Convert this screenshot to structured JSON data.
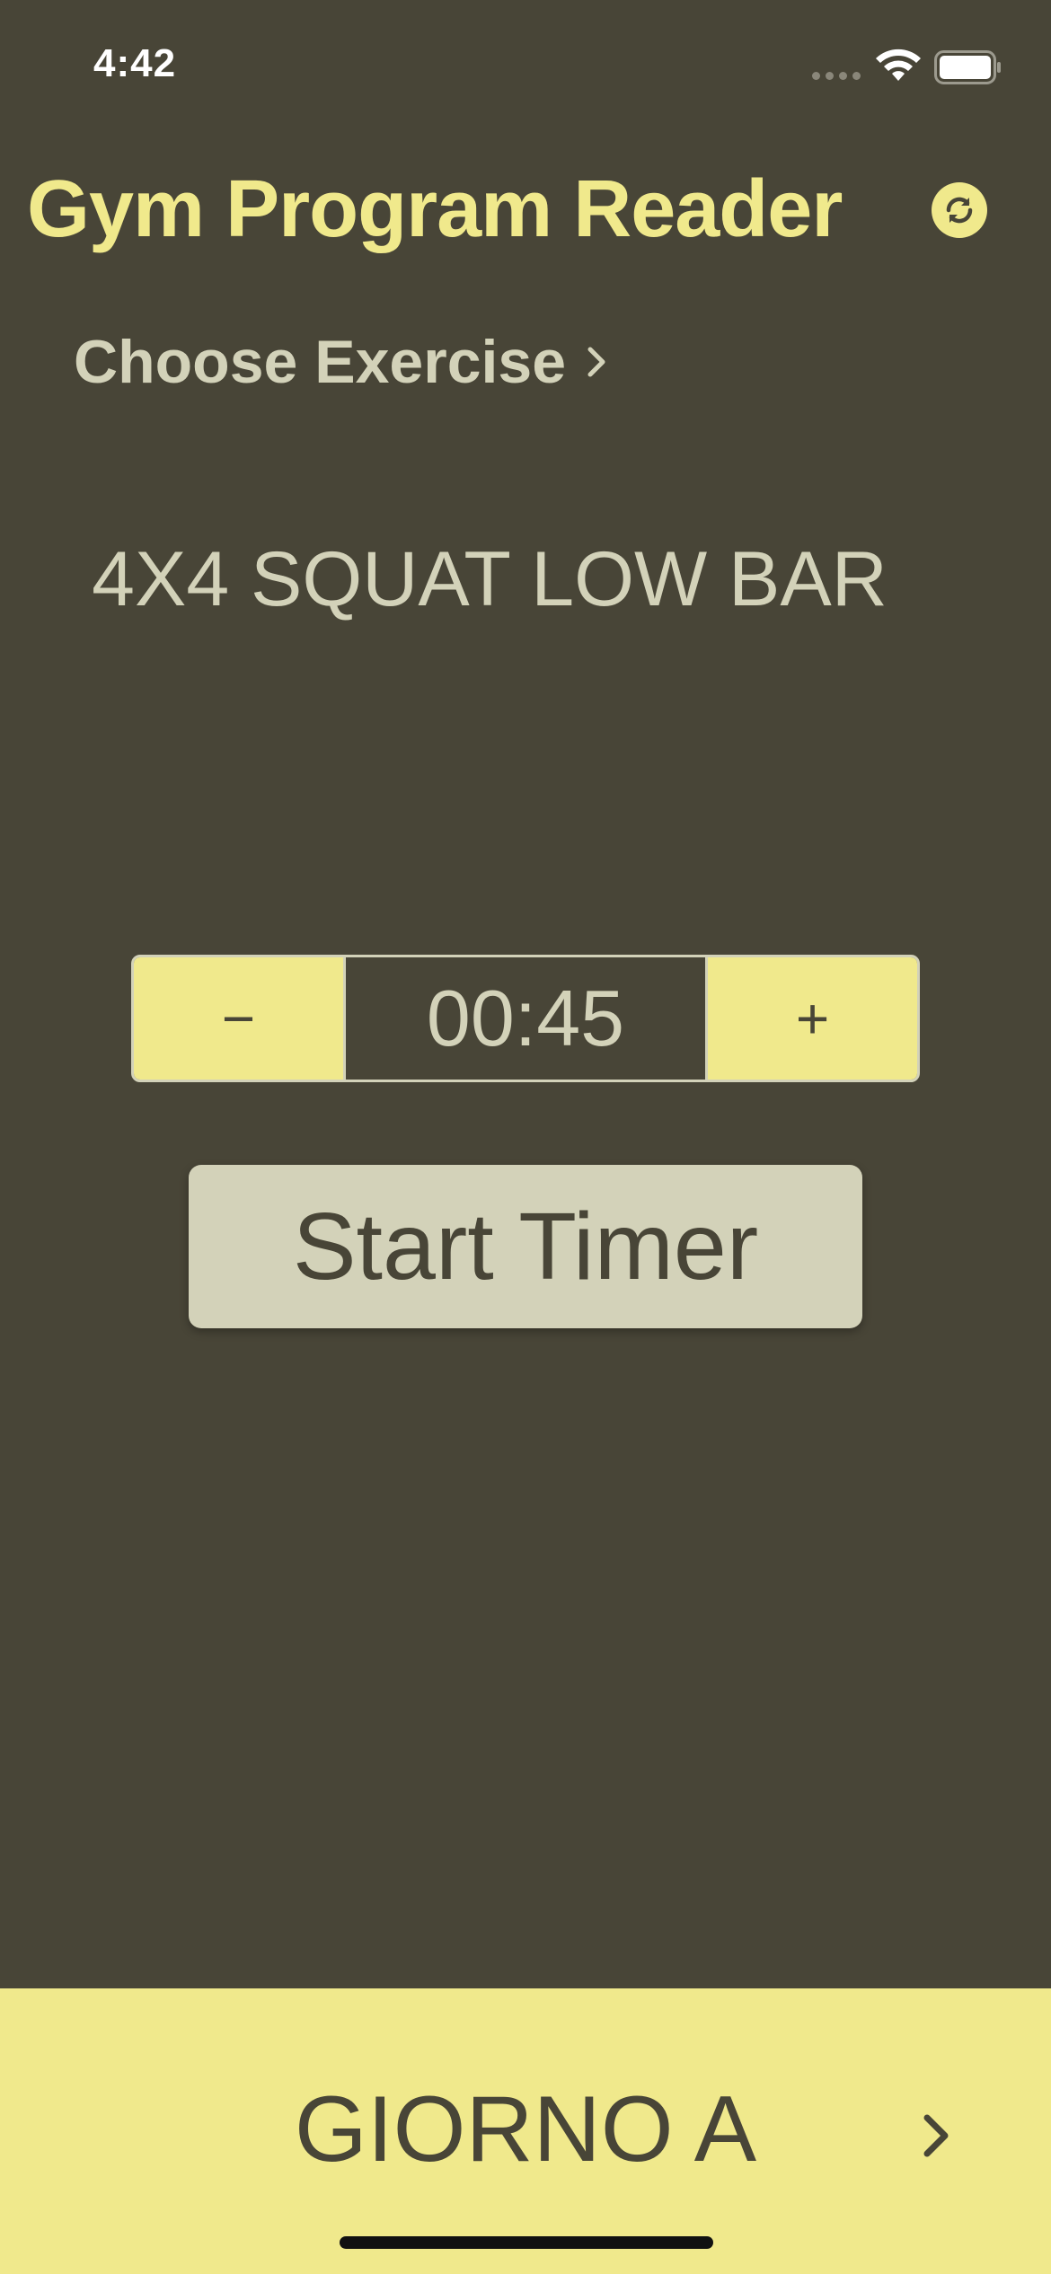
{
  "status_bar": {
    "time": "4:42"
  },
  "header": {
    "title": "Gym Program Reader",
    "refresh_icon": "refresh-icon"
  },
  "choose_exercise": {
    "label": "Choose Exercise"
  },
  "exercise": {
    "name": "4X4 SQUAT LOW BAR"
  },
  "timer": {
    "decrement_label": "−",
    "value": "00:45",
    "increment_label": "+",
    "start_label": "Start Timer"
  },
  "bottom_bar": {
    "day_label": "GIORNO A"
  },
  "colors": {
    "background": "#484537",
    "accent_yellow": "#f0e98c",
    "light_beige": "#d3d2b9"
  }
}
